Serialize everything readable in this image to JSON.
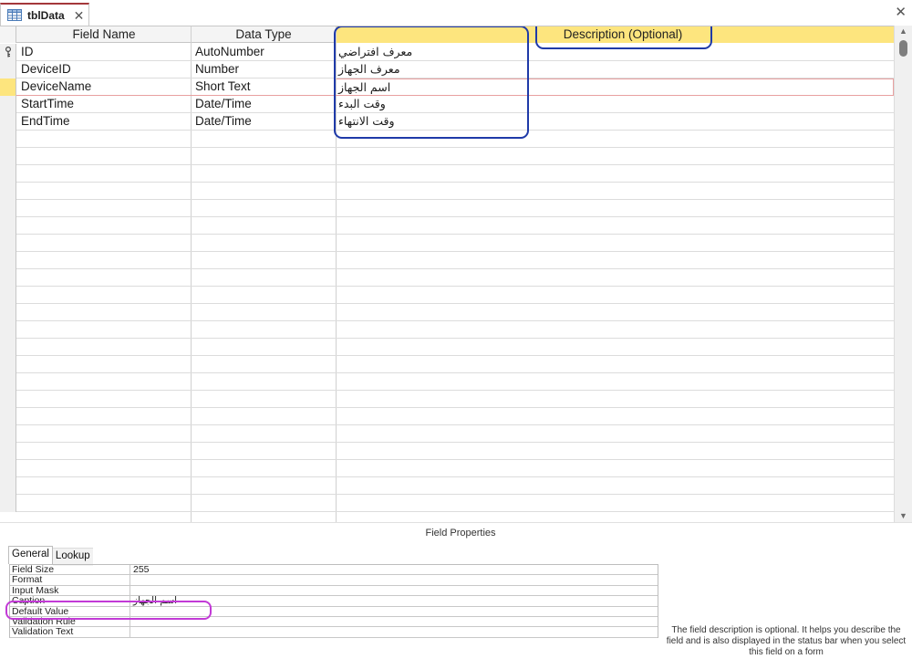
{
  "tab": {
    "title": "tblData",
    "close_glyph": "✕"
  },
  "window": {
    "close_glyph": "✕"
  },
  "grid": {
    "columns": [
      {
        "label": "Field Name"
      },
      {
        "label": "Data Type"
      },
      {
        "label": "Description (Optional)"
      }
    ],
    "rows": [
      {
        "field_name": "ID",
        "data_type": "AutoNumber",
        "description": "معرف افتراضي",
        "primary_key": true
      },
      {
        "field_name": "DeviceID",
        "data_type": "Number",
        "description": "معرف الجهاز"
      },
      {
        "field_name": "DeviceName",
        "data_type": "Short Text",
        "description": "اسم الجهاز",
        "selected": true
      },
      {
        "field_name": "StartTime",
        "data_type": "Date/Time",
        "description": "وقت البدء"
      },
      {
        "field_name": "EndTime",
        "data_type": "Date/Time",
        "description": "وقت الانتهاء"
      }
    ],
    "empty_rows": 22
  },
  "field_properties": {
    "title": "Field Properties",
    "tabs": [
      {
        "label": "General",
        "active": true
      },
      {
        "label": "Lookup",
        "active": false
      }
    ],
    "rows": [
      {
        "label": "Field Size",
        "value": "255"
      },
      {
        "label": "Format",
        "value": ""
      },
      {
        "label": "Input Mask",
        "value": ""
      },
      {
        "label": "Caption",
        "value": "اسم الجهاز"
      },
      {
        "label": "Default Value",
        "value": ""
      },
      {
        "label": "Validation Rule",
        "value": ""
      },
      {
        "label": "Validation Text",
        "value": ""
      }
    ],
    "help_text": "The field description is optional. It helps you describe the field and is also displayed in the status bar when you select this field on a form"
  },
  "colors": {
    "header_highlight": "#fde57e",
    "annotation_blue": "#1f3aa8",
    "annotation_pink": "#c23ad6",
    "tab_accent": "#a4373a"
  },
  "icons": {
    "table": "table-icon",
    "key": "primary-key-icon",
    "scroll_up": "▲",
    "scroll_down": "▼"
  }
}
